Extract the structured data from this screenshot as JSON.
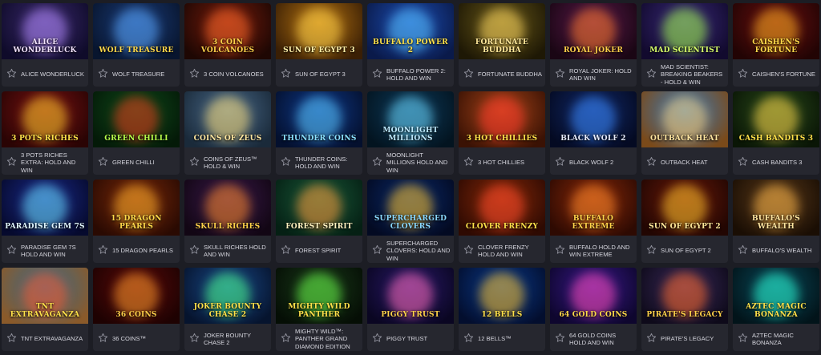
{
  "games": [
    {
      "name": "ALICE WONDERLUCK",
      "art": "ALICE WONDERLUCK",
      "bg": [
        "#3b2a6e",
        "#0f0b2a"
      ],
      "glow": "#b58cff",
      "ink": "#f3e3ff"
    },
    {
      "name": "WOLF TREASURE",
      "art": "WOLF TREASURE",
      "bg": [
        "#1b3d7a",
        "#08152e"
      ],
      "glow": "#5aa8ff",
      "ink": "#ffd94a"
    },
    {
      "name": "3 COIN VOLCANOES",
      "art": "3 COIN VOLCANOES",
      "bg": [
        "#7a1d0d",
        "#1e0703"
      ],
      "glow": "#ff6a2a",
      "ink": "#ffd34a"
    },
    {
      "name": "SUN OF EGYPT 3",
      "art": "SUN OF EGYPT 3",
      "bg": [
        "#b77512",
        "#3a1f05"
      ],
      "glow": "#ffd24a",
      "ink": "#fff0a8"
    },
    {
      "name": "BUFFALO POWER 2: HOLD AND WIN",
      "art": "BUFFALO POWER 2",
      "bg": [
        "#1d4fb5",
        "#0a1a4a"
      ],
      "glow": "#58c2ff",
      "ink": "#ffe14a"
    },
    {
      "name": "FORTUNATE BUDDHA",
      "art": "FORTUNATE BUDDHA",
      "bg": [
        "#6a5a1a",
        "#1e1805"
      ],
      "glow": "#ffd860",
      "ink": "#ffe89a"
    },
    {
      "name": "ROYAL JOKER: HOLD AND WIN",
      "art": "ROYAL JOKER",
      "bg": [
        "#5a1a4a",
        "#1a0614"
      ],
      "glow": "#ff7a2a",
      "ink": "#ffcf4a"
    },
    {
      "name": "MAD SCIENTIST: BREAKING BEAKERS - HOLD & WIN",
      "art": "MAD SCIENTIST",
      "bg": [
        "#3a2a7a",
        "#120a2e"
      ],
      "glow": "#a4ff4a",
      "ink": "#d8ff6a"
    },
    {
      "name": "CAISHEN'S FORTUNE",
      "art": "CAISHEN'S FORTUNE",
      "bg": [
        "#6a1010",
        "#220404"
      ],
      "glow": "#ffb020",
      "ink": "#ffd94a"
    },
    {
      "name": "3 POTS RICHES EXTRA: HOLD AND WIN",
      "art": "3 POTS RICHES",
      "bg": [
        "#7a1212",
        "#2a0404"
      ],
      "glow": "#ffcc2a",
      "ink": "#ffe14a"
    },
    {
      "name": "GREEN CHILLI",
      "art": "GREEN CHILLI",
      "bg": [
        "#0f4a1a",
        "#041a08"
      ],
      "glow": "#e83a1a",
      "ink": "#b8ff4a"
    },
    {
      "name": "COINS OF ZEUS™ HOLD & WIN",
      "art": "COINS OF ZEUS",
      "bg": [
        "#4a6a8a",
        "#1a2a3a"
      ],
      "glow": "#ffe07a",
      "ink": "#ffe7a0"
    },
    {
      "name": "THUNDER COINS: HOLD AND WIN",
      "art": "THUNDER COINS",
      "bg": [
        "#0f3a8a",
        "#04102e"
      ],
      "glow": "#5ac8ff",
      "ink": "#8ae0ff"
    },
    {
      "name": "MOONLIGHT MILLIONS HOLD AND WIN",
      "art": "MOONLIGHT MILLIONS",
      "bg": [
        "#0d3a5a",
        "#031420"
      ],
      "glow": "#6ad8ff",
      "ink": "#bdeaff"
    },
    {
      "name": "3 HOT CHILLIES",
      "art": "3 HOT CHILLIES",
      "bg": [
        "#a8451a",
        "#3a1204"
      ],
      "glow": "#ff3a2a",
      "ink": "#ffe14a"
    },
    {
      "name": "BLACK WOLF 2",
      "art": "BLACK WOLF 2",
      "bg": [
        "#122a6a",
        "#040a22"
      ],
      "glow": "#3a8aff",
      "ink": "#e6ecff"
    },
    {
      "name": "OUTBACK HEAT",
      "art": "OUTBACK HEAT",
      "bg": [
        "#3a7ab8",
        "#7a4a1a"
      ],
      "glow": "#ffd27a",
      "ink": "#ffe5a0"
    },
    {
      "name": "CASH BANDITS 3",
      "art": "CASH BANDITS 3",
      "bg": [
        "#2a4a1a",
        "#0a1606"
      ],
      "glow": "#ffd84a",
      "ink": "#ffe14a"
    },
    {
      "name": "PARADISE GEM 7S HOLD AND WIN",
      "art": "PARADISE GEM 7S",
      "bg": [
        "#1a2a8a",
        "#060a2e"
      ],
      "glow": "#6ae0ff",
      "ink": "#e0f6ff"
    },
    {
      "name": "15 DRAGON PEARLS",
      "art": "15 DRAGON PEARLS",
      "bg": [
        "#7a2a0a",
        "#2a0a02"
      ],
      "glow": "#ffb02a",
      "ink": "#ffd94a"
    },
    {
      "name": "SKULL RICHES HOLD AND WIN",
      "art": "SKULL RICHES",
      "bg": [
        "#3a1a4a",
        "#120614"
      ],
      "glow": "#ff8a2a",
      "ink": "#ffd24a"
    },
    {
      "name": "FOREST SPIRIT",
      "art": "FOREST SPIRIT",
      "bg": [
        "#1a5a3a",
        "#052014"
      ],
      "glow": "#ff9a3a",
      "ink": "#fff2c0"
    },
    {
      "name": "SUPERCHARGED CLOVERS: HOLD AND WIN",
      "art": "SUPERCHARGED CLOVERS",
      "bg": [
        "#0a2a6a",
        "#030a22"
      ],
      "glow": "#ffc42a",
      "ink": "#8ad8ff"
    },
    {
      "name": "CLOVER FRENZY HOLD AND WIN",
      "art": "CLOVER FRENZY",
      "bg": [
        "#8a2a0a",
        "#2e0a02"
      ],
      "glow": "#ff4a2a",
      "ink": "#ffe14a"
    },
    {
      "name": "BUFFALO HOLD AND WIN EXTREME",
      "art": "BUFFALO EXTREME",
      "bg": [
        "#8a2a0a",
        "#2e0a02"
      ],
      "glow": "#ff8a2a",
      "ink": "#ffd24a"
    },
    {
      "name": "SUN OF EGYPT 2",
      "art": "SUN OF EGYPT 2",
      "bg": [
        "#6a1a0a",
        "#220602"
      ],
      "glow": "#ffc42a",
      "ink": "#ffe89a"
    },
    {
      "name": "BUFFALO'S WEALTH",
      "art": "BUFFALO'S WEALTH",
      "bg": [
        "#5a3a1a",
        "#1a0e04"
      ],
      "glow": "#ffb84a",
      "ink": "#ffe5a0"
    },
    {
      "name": "TNT EXTRAVAGANZA",
      "art": "TNT EXTRAVAGANZA",
      "bg": [
        "#3a6a8a",
        "#8a5a2a"
      ],
      "glow": "#ff5a2a",
      "ink": "#ffe14a"
    },
    {
      "name": "36 COINS™",
      "art": "36 COINS",
      "bg": [
        "#5a0a0a",
        "#1e0202"
      ],
      "glow": "#ff9a2a",
      "ink": "#ffcf4a"
    },
    {
      "name": "JOKER BOUNTY CHASE 2",
      "art": "JOKER BOUNTY CHASE 2",
      "bg": [
        "#1a4a8a",
        "#06142e"
      ],
      "glow": "#4aff8a",
      "ink": "#ffe14a"
    },
    {
      "name": "MIGHTY WILD™: PANTHER GRAND DIAMOND EDITION",
      "art": "MIGHTY WILD PANTHER",
      "bg": [
        "#1a3a1a",
        "#050e05"
      ],
      "glow": "#6aff4a",
      "ink": "#ffe14a"
    },
    {
      "name": "PIGGY TRUST",
      "art": "PIGGY TRUST",
      "bg": [
        "#2a1a6a",
        "#0a0622"
      ],
      "glow": "#ff6ab8",
      "ink": "#ffd24a"
    },
    {
      "name": "12 BELLS™",
      "art": "12 BELLS",
      "bg": [
        "#0a3a8a",
        "#030e2e"
      ],
      "glow": "#ffc42a",
      "ink": "#ffe14a"
    },
    {
      "name": "64 GOLD COINS HOLD AND WIN",
      "art": "64 GOLD COINS",
      "bg": [
        "#3a1a8a",
        "#0e062e"
      ],
      "glow": "#ff4ab8",
      "ink": "#ffd94a"
    },
    {
      "name": "PIRATE'S LEGACY",
      "art": "PIRATE'S LEGACY",
      "bg": [
        "#3a2a5a",
        "#0e0a1a"
      ],
      "glow": "#ff6a2a",
      "ink": "#ffd24a"
    },
    {
      "name": "AZTEC MAGIC BONANZA",
      "art": "AZTEC MAGIC BONANZA",
      "bg": [
        "#0a4a5a",
        "#02141a"
      ],
      "glow": "#2affd8",
      "ink": "#ffe14a"
    }
  ],
  "colors": {
    "page_bg": "#1c1d24",
    "tile_footer": "#26272f",
    "text": "#d6d6de",
    "star_stroke": "#8a8b96"
  }
}
